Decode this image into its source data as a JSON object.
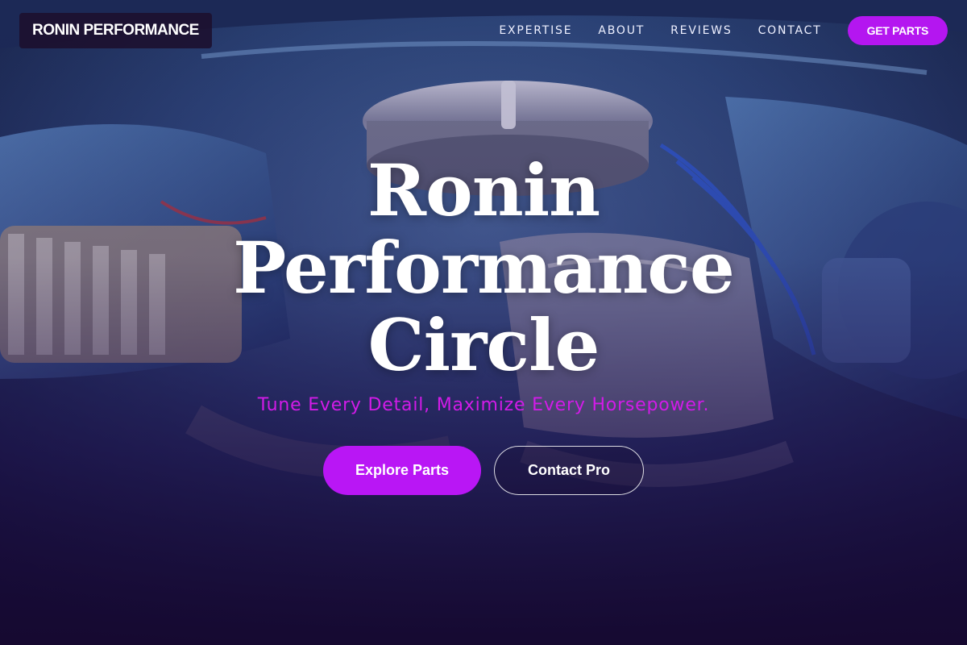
{
  "brand": {
    "name": "RONIN PERFORMANCE"
  },
  "nav": {
    "links": [
      "EXPERTISE",
      "ABOUT",
      "REVIEWS",
      "CONTACT"
    ],
    "cta_label": "GET PARTS"
  },
  "hero": {
    "title_lines": [
      "Ronin",
      "Performance",
      "Circle"
    ],
    "tagline": "Tune Every Detail, Maximize Every Horsepower.",
    "primary_button": "Explore Parts",
    "secondary_button": "Contact Pro",
    "background": "engine-bay-photo"
  },
  "colors": {
    "accent": "#b916f5",
    "tagline": "#d21be8",
    "overlay": "#1c0c3c"
  }
}
